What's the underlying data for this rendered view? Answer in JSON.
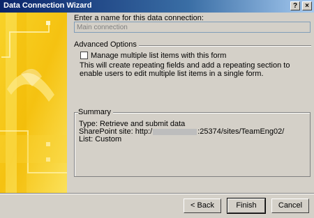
{
  "window": {
    "title": "Data Connection Wizard",
    "help_glyph": "?",
    "close_glyph": "×"
  },
  "name_section": {
    "label": "Enter a name for this data connection:",
    "value": "Main connection"
  },
  "advanced": {
    "group_title": "Advanced Options",
    "checkbox_label": "Manage multiple list items with this form",
    "checked": false,
    "description": "This will create repeating fields and add a repeating section to enable users to edit multiple list items in a single form."
  },
  "summary": {
    "group_title": "Summary",
    "type_line": "Type: Retrieve and submit data",
    "site_prefix": "SharePoint site: http:/",
    "site_suffix": ":25374/sites/TeamEng02/",
    "list_line": "List: Custom"
  },
  "buttons": {
    "back": "< Back",
    "finish": "Finish",
    "cancel": "Cancel"
  },
  "colors": {
    "titlebar_start": "#0a246a",
    "dialog_bg": "#d4d0c8",
    "sidebar_yellow": "#f6cc18"
  }
}
